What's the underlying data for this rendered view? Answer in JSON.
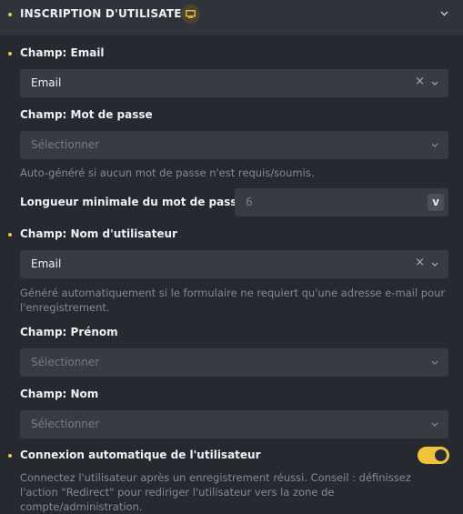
{
  "section": {
    "title": "INSCRIPTION D'UTILISATEUR"
  },
  "email": {
    "label": "Champ: Email",
    "value": "Email",
    "clear": "×"
  },
  "password": {
    "label": "Champ: Mot de passe",
    "placeholder": "Sélectionner",
    "help": "Auto-généré si aucun mot de passe n'est requis/soumis."
  },
  "min_length": {
    "label": "Longueur minimale du mot de passe",
    "value": "6",
    "button": "v"
  },
  "username": {
    "label": "Champ: Nom d'utilisateur",
    "value": "Email",
    "clear": "×",
    "help": "Généré automatiquement si le formulaire ne requiert qu'une adresse e-mail pour l'enregistrement."
  },
  "first_name": {
    "label": "Champ: Prénom",
    "placeholder": "Sélectionner"
  },
  "last_name": {
    "label": "Champ: Nom",
    "placeholder": "Sélectionner"
  },
  "auto_login": {
    "label": "Connexion automatique de l'utilisateur",
    "enabled": true,
    "help": "Connectez l'utilisateur après un enregistrement réussi. Conseil : définissez l'action \"Redirect\" pour rediriger l'utilisateur vers la zone de compte/administration."
  },
  "colors": {
    "accent": "#f4c542",
    "background": "#262a30",
    "field": "#373b42"
  },
  "icons": [
    "monitor-icon",
    "chevron-down-icon",
    "clear-icon"
  ]
}
